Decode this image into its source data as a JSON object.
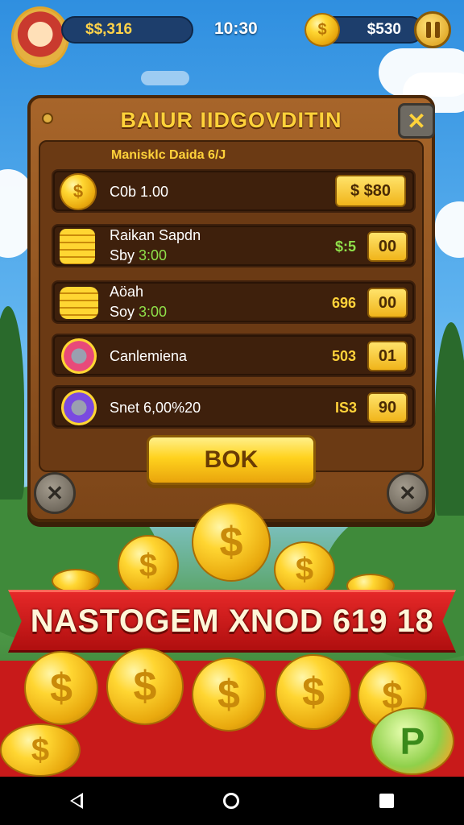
{
  "hud": {
    "money": "$$,316",
    "time": "10:30",
    "coins": "$530"
  },
  "panel": {
    "title": "BAIUR IIDGOVDITIN",
    "subtitle": "Manisklc Daida 6/J",
    "items": [
      {
        "name": "C0b 1.00",
        "sub_prefix": "",
        "sub_value": "",
        "amount": "",
        "button": "$ $80"
      },
      {
        "name": "Raikan Sapdn",
        "sub_prefix": "Sby ",
        "sub_value": "3:00",
        "amount": "$:5",
        "button": "00"
      },
      {
        "name": "Aöah",
        "sub_prefix": "Soy ",
        "sub_value": "3:00",
        "amount": "696",
        "button": "00"
      },
      {
        "name": "Canlemiena",
        "sub_prefix": "",
        "sub_value": "",
        "amount": "503",
        "button": "01"
      },
      {
        "name": "Snet 6,00%20",
        "sub_prefix": "",
        "sub_value": "",
        "amount": "IS3",
        "button": "90"
      }
    ],
    "ok_label": "BOK"
  },
  "banner": {
    "text": "NASTOGEM XNOD 619 18"
  },
  "colors": {
    "gold": "#ffd23a",
    "wood": "#7c4518",
    "banner_red": "#d41e1e"
  }
}
